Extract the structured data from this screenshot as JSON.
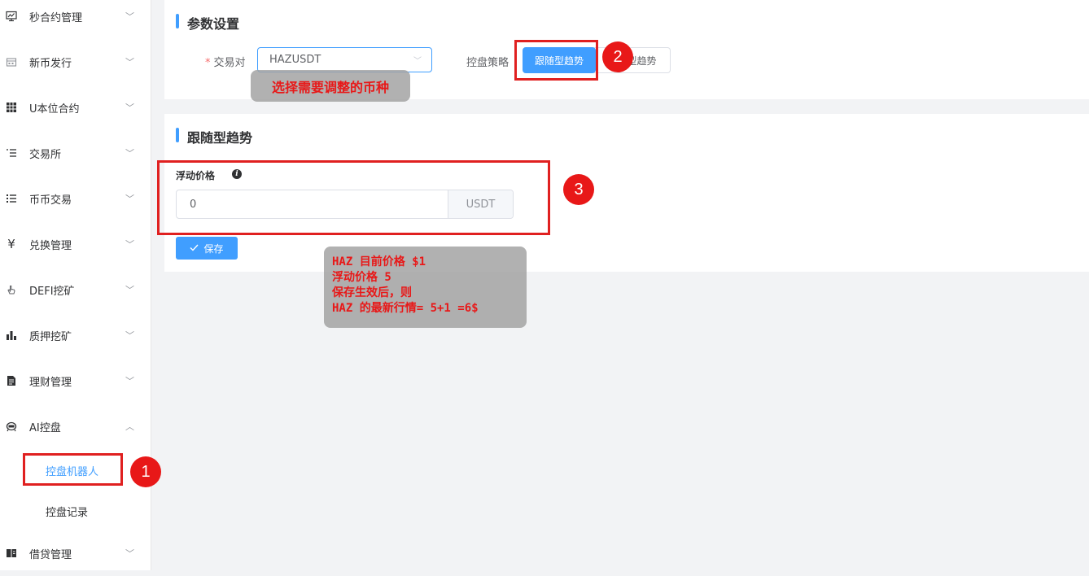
{
  "sidebar": {
    "items": [
      {
        "label": "秒合约管理",
        "icon": "monitor-icon"
      },
      {
        "label": "新币发行",
        "icon": "calendar-icon"
      },
      {
        "label": "U本位合约",
        "icon": "grid-icon"
      },
      {
        "label": "交易所",
        "icon": "list-icon"
      },
      {
        "label": "币币交易",
        "icon": "menu-icon"
      },
      {
        "label": "兑换管理",
        "icon": "yen-icon"
      },
      {
        "label": "DEFI挖矿",
        "icon": "hand-icon"
      },
      {
        "label": "质押挖矿",
        "icon": "bar-chart-icon"
      },
      {
        "label": "理财管理",
        "icon": "document-icon"
      },
      {
        "label": "AI控盘",
        "icon": "robot-icon"
      },
      {
        "label": "借贷管理",
        "icon": "book-icon"
      }
    ],
    "sub_items": [
      {
        "label": "控盘机器人"
      },
      {
        "label": "控盘记录"
      }
    ]
  },
  "params_section": {
    "title": "参数设置",
    "pair_label": "交易对",
    "pair_value": "HAZUSDT",
    "strategy_label": "控盘策略",
    "strategy_active": "跟随型趋势",
    "strategy_other": "型趋势"
  },
  "follow_section": {
    "title": "跟随型趋势",
    "float_price_label": "浮动价格",
    "float_price_value": "0",
    "unit": "USDT",
    "save_label": "保存"
  },
  "annotations": {
    "circle1": "1",
    "circle2": "2",
    "circle3": "3",
    "tooltip_select": "选择需要调整的币种",
    "tooltip_lines": [
      "HAZ 目前价格 $1",
      "浮动价格 5",
      "保存生效后，则",
      "HAZ 的最新行情= 5+1 =6$"
    ]
  },
  "colors": {
    "accent": "#409eff",
    "annotation_red": "#e02020"
  }
}
